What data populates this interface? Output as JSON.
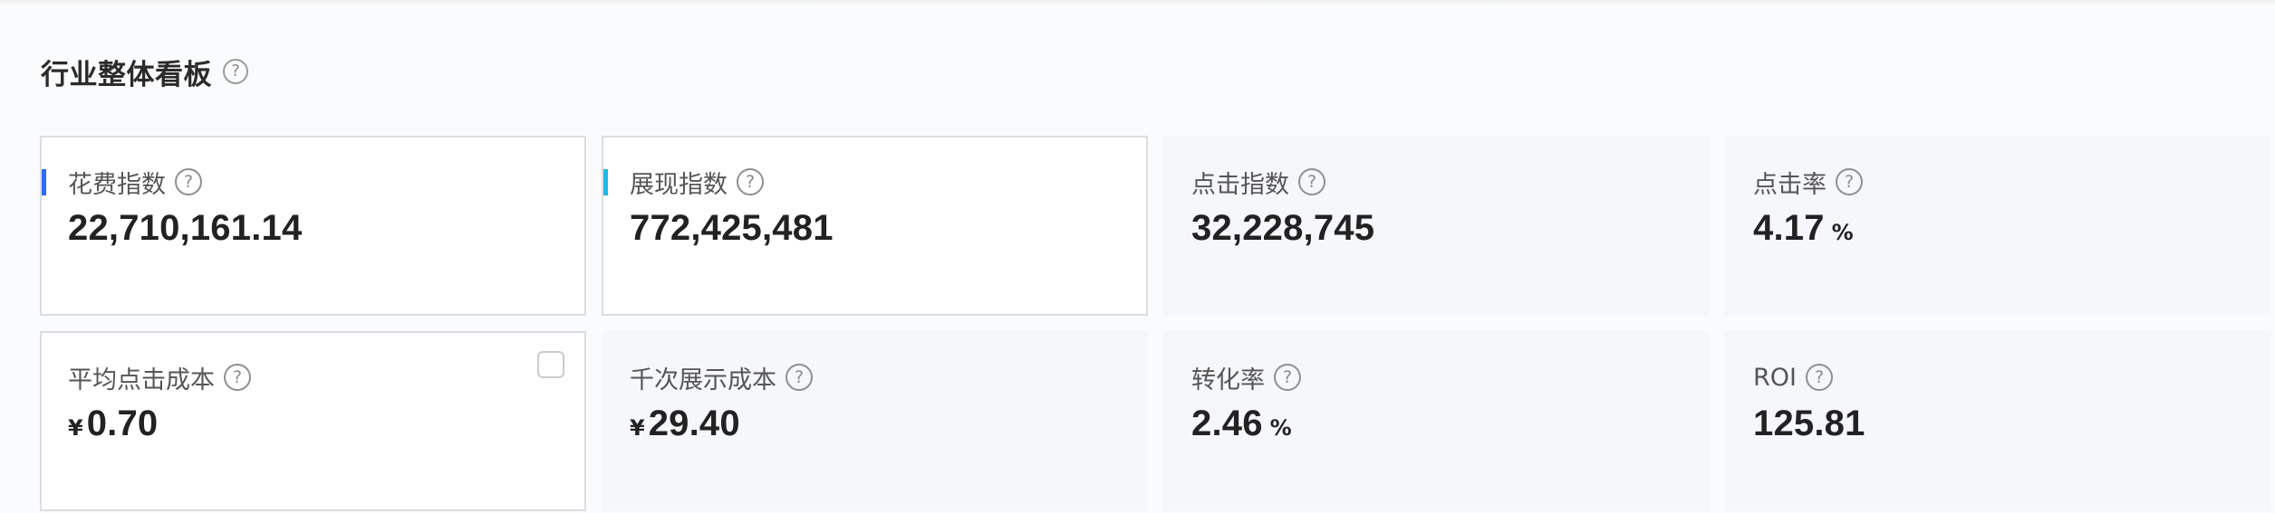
{
  "section": {
    "title": "行业整体看板",
    "help": "?"
  },
  "cards": [
    {
      "label": "花费指数",
      "prefix": "",
      "value": "22,710,161.14",
      "unit": "",
      "help": "?"
    },
    {
      "label": "展现指数",
      "prefix": "",
      "value": "772,425,481",
      "unit": "",
      "help": "?"
    },
    {
      "label": "点击指数",
      "prefix": "",
      "value": "32,228,745",
      "unit": "",
      "help": "?"
    },
    {
      "label": "点击率",
      "prefix": "",
      "value": "4.17",
      "unit": "%",
      "help": "?"
    },
    {
      "label": "平均点击成本",
      "prefix": "¥",
      "value": "0.70",
      "unit": "",
      "help": "?"
    },
    {
      "label": "千次展示成本",
      "prefix": "¥",
      "value": "29.40",
      "unit": "",
      "help": "?"
    },
    {
      "label": "转化率",
      "prefix": "",
      "value": "2.46",
      "unit": "%",
      "help": "?"
    },
    {
      "label": "ROI",
      "prefix": "",
      "value": "125.81",
      "unit": "",
      "help": "?"
    }
  ],
  "colors": {
    "accent_blue": "#2f6bff",
    "accent_cyan": "#1fb8e6",
    "card_bg": "#f5f7fa",
    "selected_border": "#dcdde0"
  }
}
